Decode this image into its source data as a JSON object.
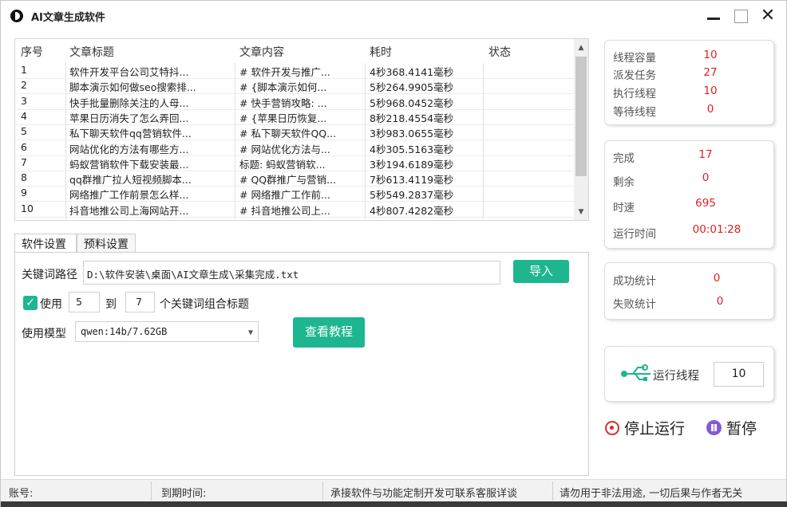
{
  "window": {
    "title": "AI文章生成软件"
  },
  "table": {
    "headers": [
      "序号",
      "文章标题",
      "文章内容",
      "耗时",
      "状态"
    ],
    "rows": [
      {
        "no": "1",
        "title": "软件开发平台公司艾特抖...",
        "content": "# 软件开发与推广...",
        "time": "4秒368.4141毫秒",
        "status": ""
      },
      {
        "no": "2",
        "title": "脚本演示如何做seo搜索排...",
        "content": "# {脚本演示如何...",
        "time": "5秒264.9905毫秒",
        "status": ""
      },
      {
        "no": "3",
        "title": "快手批量删除关注的人母...",
        "content": "# 快手营销攻略: ...",
        "time": "5秒968.0452毫秒",
        "status": ""
      },
      {
        "no": "4",
        "title": "苹果日历消失了怎么弄回...",
        "content": "# {苹果日历恢复...",
        "time": "8秒218.4554毫秒",
        "status": ""
      },
      {
        "no": "5",
        "title": "私下聊天软件qq营销软件...",
        "content": "# 私下聊天软件QQ...",
        "time": "3秒983.0655毫秒",
        "status": ""
      },
      {
        "no": "6",
        "title": "网站优化的方法有哪些方...",
        "content": "# 网站优化方法与...",
        "time": "4秒305.5163毫秒",
        "status": ""
      },
      {
        "no": "7",
        "title": "蚂蚁营销软件下载安装最...",
        "content": "标题: 蚂蚁营销软...",
        "time": "3秒194.6189毫秒",
        "status": ""
      },
      {
        "no": "8",
        "title": "qq群推广拉人短视频脚本...",
        "content": "# QQ群推广与营销...",
        "time": "7秒613.4119毫秒",
        "status": ""
      },
      {
        "no": "9",
        "title": "网络推广工作前景怎么样...",
        "content": "# 网络推广工作前...",
        "time": "5秒549.2837毫秒",
        "status": ""
      },
      {
        "no": "10",
        "title": "抖音地推公司上海网站开...",
        "content": "# 抖音地推公司上...",
        "time": "4秒807.4282毫秒",
        "status": ""
      }
    ]
  },
  "tabs": {
    "software": "软件设置",
    "prompt": "预料设置"
  },
  "settings": {
    "keyword_path_label": "关键词路径",
    "keyword_path_value": "D:\\软件安装\\桌面\\AI文章生成\\采集完成.txt",
    "import_label": "导入",
    "use_label": "使用",
    "min_value": "5",
    "to_label": "到",
    "max_value": "7",
    "combo_label": "个关键词组合标题",
    "model_label": "使用模型",
    "model_value": "qwen:14b/7.62GB",
    "tutorial_label": "查看教程",
    "check_mark": "✓"
  },
  "stats1": {
    "capacity_label": "线程容量",
    "capacity": "10",
    "dispatch_label": "派发任务",
    "dispatch": "27",
    "exec_label": "执行线程",
    "exec": "10",
    "wait_label": "等待线程",
    "wait": "0"
  },
  "stats2": {
    "done_label": "完成",
    "done": "17",
    "remain_label": "剩余",
    "remain": "0",
    "speed_label": "时速",
    "speed": "695",
    "runtime_label": "运行时间",
    "runtime": "00:01:28"
  },
  "stats3": {
    "success_label": "成功统计",
    "success": "0",
    "fail_label": "失败统计",
    "fail": "0"
  },
  "threads": {
    "label": "运行线程",
    "value": "10"
  },
  "actions": {
    "stop": "停止运行",
    "pause": "暂停"
  },
  "statusbar": {
    "account": "账号:",
    "expire": "到期时间:",
    "custom": "承接软件与功能定制开发可联系客服详谈",
    "warning": "请勿用于非法用途, 一切后果与作者无关"
  },
  "colors": {
    "accent": "#1eb68f",
    "value_red": "#e02020",
    "pause_purple": "#8659d8",
    "stop_red": "#d62c2c"
  }
}
